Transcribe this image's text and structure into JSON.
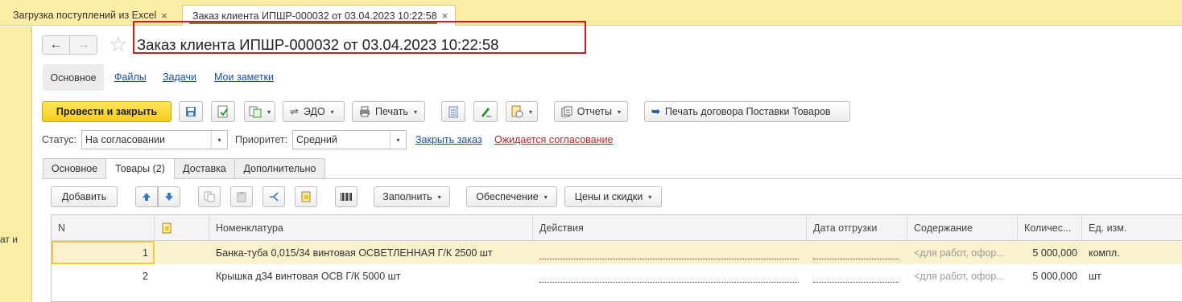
{
  "tabstrip": {
    "tabs": [
      {
        "label": "Загрузка поступлений из Excel",
        "close": "×"
      },
      {
        "label": "Заказ клиента ИПШР-000032 от 03.04.2023 10:22:58",
        "close": "×"
      }
    ]
  },
  "left_panel": {
    "sliver_text": "ат и"
  },
  "header": {
    "back": "←",
    "forward": "→",
    "star": "☆",
    "title": "Заказ клиента ИПШР-000032 от 03.04.2023 10:22:58"
  },
  "section_nav": {
    "active": "Основное",
    "links": [
      "Файлы",
      "Задачи",
      "Мои заметки"
    ]
  },
  "toolbar": {
    "post_and_close": "Провести и закрыть",
    "edo": "ЭДО",
    "print": "Печать",
    "reports": "Отчеты",
    "print_contract": "Печать договора Поставки Товаров",
    "dropdown_glyph": "▾"
  },
  "status_row": {
    "status_label": "Статус:",
    "status_value": "На согласовании",
    "priority_label": "Приоритет:",
    "priority_value": "Средний",
    "close_order_link": "Закрыть заказ",
    "awaiting_link": "Ожидается согласование"
  },
  "doc_tabs": [
    "Основное",
    "Товары (2)",
    "Доставка",
    "Дополнительно"
  ],
  "table_toolbar": {
    "add": "Добавить",
    "fill": "Заполнить",
    "provision": "Обеспечение",
    "prices": "Цены и скидки"
  },
  "grid": {
    "columns": [
      "N",
      "",
      "Номенклатура",
      "Действия",
      "Дата отгрузки",
      "Содержание",
      "Количес...",
      "Ед. изм."
    ],
    "rows": [
      {
        "n": "1",
        "item": "Банка-туба 0,015/34 винтовая ОСВЕТЛЕННАЯ Г/К 2500 шт",
        "content": "<для работ, офор...",
        "qty": "5 000,000",
        "unit": "компл."
      },
      {
        "n": "2",
        "item": "Крышка д34 винтовая ОСВ Г/К 5000 шт",
        "content": "<для работ, офор...",
        "qty": "5 000,000",
        "unit": "шт"
      }
    ]
  },
  "colors": {
    "tabstrip_bg": "#fbeda6",
    "primary_button": "#f4cd1c",
    "link": "#1b4fa0",
    "alert_link": "#c0202a",
    "highlight_box": "#e0141e",
    "selected_row": "#fbf1cd"
  }
}
